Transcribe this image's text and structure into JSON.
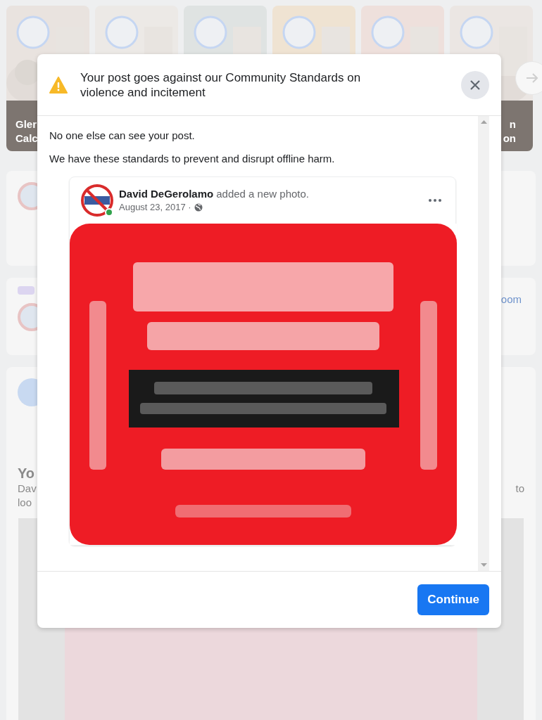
{
  "stories": [
    {
      "kind": "picture",
      "caption": [
        "Gler",
        "Calc"
      ]
    },
    {
      "kind": "picture"
    },
    {
      "kind": "picture"
    },
    {
      "kind": "picture"
    },
    {
      "kind": "picture"
    },
    {
      "kind": "picture",
      "caption": [
        "n",
        "on"
      ]
    }
  ],
  "feed_fragments": {
    "create_room": "oom",
    "title": "Yo",
    "body_left": [
      "Dav",
      "loo"
    ],
    "body_right": "to"
  },
  "dialog": {
    "title": "Your post goes against our Community Standards on violence and incitement",
    "paragraphs": [
      "No one else can see your post.",
      "We have these standards to prevent and disrupt offline harm."
    ],
    "post": {
      "author": "David DeGerolamo",
      "action": "added a new photo.",
      "date": "August 23, 2017 ·",
      "online": true,
      "photo": {
        "kind": "picture"
      }
    },
    "button": "Continue"
  }
}
